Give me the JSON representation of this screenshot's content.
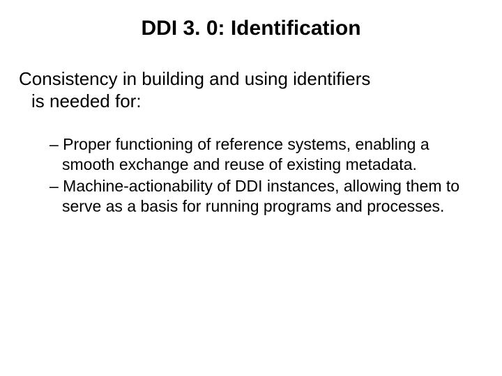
{
  "title": "DDI 3. 0: Identification",
  "intro_line1": "Consistency in building and using identifiers",
  "intro_line2": "is needed for:",
  "bullets": [
    "– Proper functioning of reference systems, enabling a smooth exchange and reuse of existing metadata.",
    "– Machine-actionability of DDI instances, allowing them to serve as a basis for running programs and processes."
  ]
}
